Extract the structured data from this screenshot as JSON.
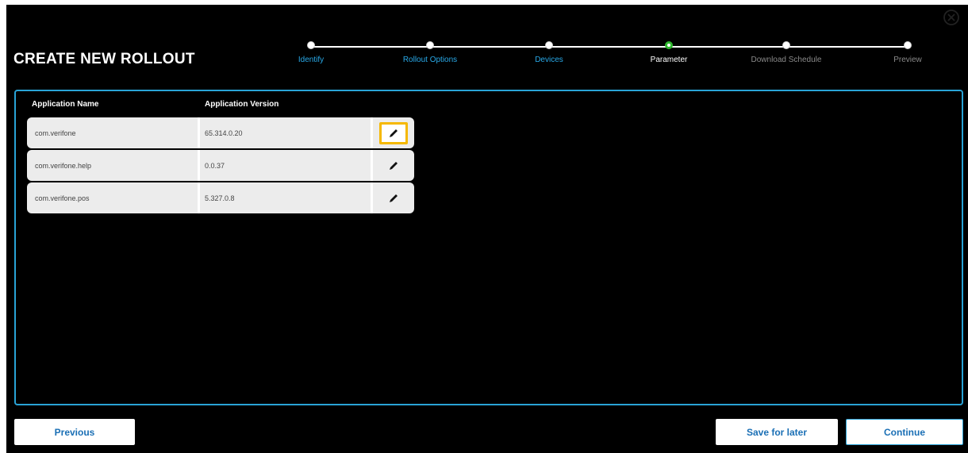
{
  "dialog": {
    "title": "CREATE NEW ROLLOUT",
    "close_icon": "close-circle-icon"
  },
  "stepper": {
    "steps": [
      {
        "label": "Identify",
        "state": "done"
      },
      {
        "label": "Rollout Options",
        "state": "done"
      },
      {
        "label": "Devices",
        "state": "done"
      },
      {
        "label": "Parameter",
        "state": "active"
      },
      {
        "label": "Download Schedule",
        "state": "todo"
      },
      {
        "label": "Preview",
        "state": "todo"
      }
    ],
    "colors": {
      "done": "#29a9e8",
      "active": "#2eb82e",
      "todo": "#8a8a8a"
    }
  },
  "table": {
    "headers": {
      "name": "Application Name",
      "version": "Application Version"
    },
    "rows": [
      {
        "name": "com.verifone",
        "version": "65.314.0.20",
        "highlighted": true
      },
      {
        "name": "com.verifone.help",
        "version": "0.0.37",
        "highlighted": false
      },
      {
        "name": "com.verifone.pos",
        "version": "5.327.0.8",
        "highlighted": false
      }
    ],
    "edit_icon": "pencil-icon",
    "highlight_color": "#f5b800",
    "border_color": "#29a3d6"
  },
  "footer": {
    "previous_label": "Previous",
    "save_label": "Save for later",
    "continue_label": "Continue",
    "button_text_color": "#1a6fb5"
  }
}
